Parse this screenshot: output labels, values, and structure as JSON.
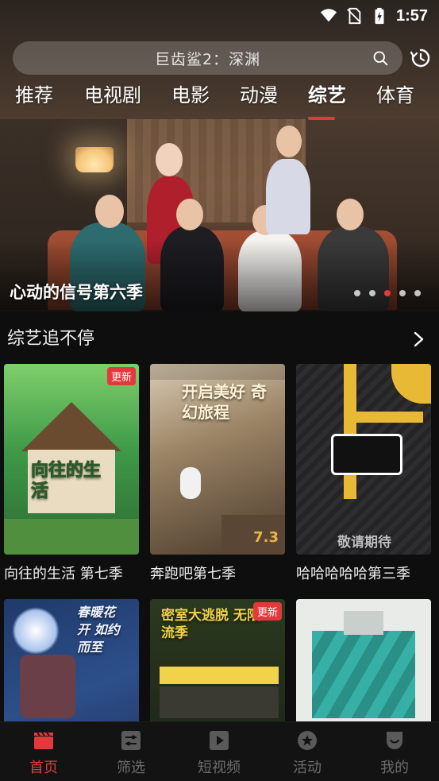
{
  "status_bar": {
    "time": "1:57"
  },
  "search": {
    "placeholder_text": "巨齿鲨2：深渊"
  },
  "tabs": [
    {
      "label": "推荐",
      "active": false
    },
    {
      "label": "电视剧",
      "active": false
    },
    {
      "label": "电影",
      "active": false
    },
    {
      "label": "动漫",
      "active": false
    },
    {
      "label": "综艺",
      "active": true
    },
    {
      "label": "体育",
      "active": false
    }
  ],
  "banner": {
    "title": "心动的信号第六季",
    "slide_count": 5,
    "active_slide": 3
  },
  "section": {
    "title": "综艺追不停",
    "items": [
      {
        "title": "向往的生活 第七季",
        "badge": "更新",
        "poster_text": "向往的生活"
      },
      {
        "title": "奔跑吧第七季",
        "badge": "",
        "score": "7.3",
        "poster_text": "开启美好 奇幻旅程"
      },
      {
        "title": "哈哈哈哈哈第三季",
        "badge": "",
        "poster_text": "敬请期待"
      },
      {
        "title": "",
        "badge": "",
        "poster_text": "春暖花开 如约而至"
      },
      {
        "title": "",
        "badge": "更新",
        "poster_text": "密室大逃脱 无限流季"
      },
      {
        "title": "",
        "badge": "",
        "poster_text": ""
      }
    ]
  },
  "bottom_nav": [
    {
      "label": "首页",
      "active": true
    },
    {
      "label": "筛选",
      "active": false
    },
    {
      "label": "短视频",
      "active": false
    },
    {
      "label": "活动",
      "active": false
    },
    {
      "label": "我的",
      "active": false
    }
  ],
  "colors": {
    "accent": "#e4393c",
    "background": "#0e0e0e",
    "inactive": "#6c6c6c"
  }
}
